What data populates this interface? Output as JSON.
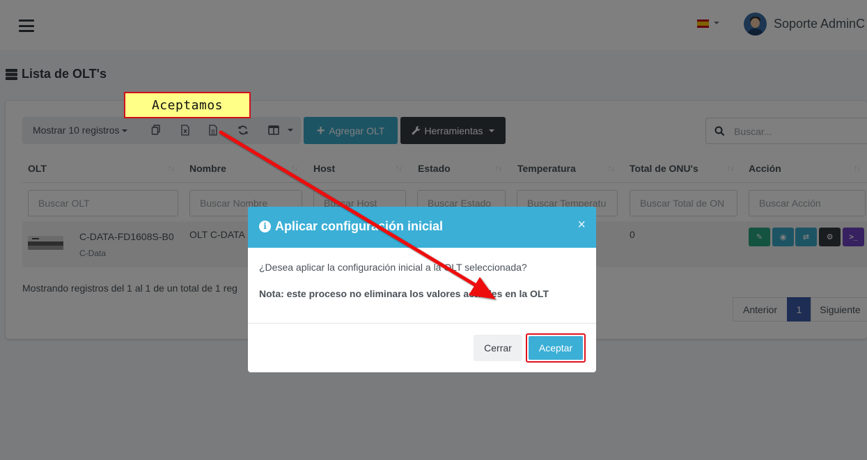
{
  "navbar": {
    "menu_icon": "hamburger-icon",
    "language_flag": "spain-flag-icon",
    "user_name": "Soporte AdminC"
  },
  "page": {
    "title": "Lista de OLT's",
    "title_icon": "server-icon"
  },
  "toolbar": {
    "show_records": "Mostrar 10 registros",
    "icons": [
      "copy-icon",
      "excel-icon",
      "csv-icon",
      "refresh-icon",
      "columns-icon"
    ],
    "add_label": "Agregar OLT",
    "tools_label": "Herramientas",
    "search_placeholder": "Buscar..."
  },
  "table": {
    "columns": [
      "OLT",
      "Nombre",
      "Host",
      "Estado",
      "Temperatura",
      "Total de ONU's",
      "Acción"
    ],
    "filters": [
      "Buscar OLT",
      "Buscar Nombre",
      "Buscar Host",
      "Buscar Estado",
      "Buscar Temperatu",
      "Buscar Total de ON",
      "Buscar Acción"
    ],
    "rows": [
      {
        "olt_model": "C-DATA-FD1608S-B0",
        "olt_brand": "C-Data",
        "nombre": "OLT C-DATA",
        "total_onus": "0",
        "actions": [
          "edit-icon",
          "view-icon",
          "transfer-icon",
          "settings-icon",
          "terminal-icon"
        ]
      }
    ],
    "info": "Mostrando registros del 1 al 1 de un total de 1 reg",
    "pagination": {
      "prev": "Anterior",
      "current": "1",
      "next": "Siguiente"
    }
  },
  "modal": {
    "title": "Aplicar configuración inicial",
    "close_glyph": "×",
    "question": "¿Desea aplicar la configuración inicial a la OLT seleccionada?",
    "note": "Nota: este proceso no eliminara los valores actuales en la OLT",
    "cancel_label": "Cerrar",
    "accept_label": "Aceptar"
  },
  "annotation": {
    "callout_text": "Aceptamos",
    "colors": {
      "callout_bg": "#ffff88",
      "highlight": "#e0121b"
    }
  },
  "colors": {
    "info": "#3bafd6",
    "dark": "#343a40",
    "primary": "#3c5aa6"
  }
}
